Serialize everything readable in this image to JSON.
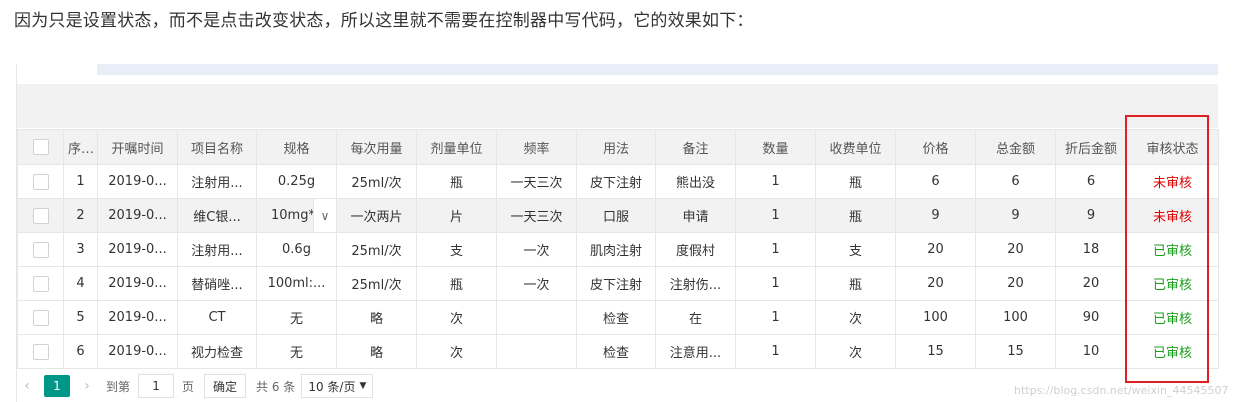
{
  "intro_text": "因为只是设置状态，而不是点击改变状态，所以这里就不需要在控制器中写代码，它的效果如下：",
  "columns": [
    "序号",
    "开嘱时间",
    "项目名称",
    "规格",
    "每次用量",
    "剂量单位",
    "频率",
    "用法",
    "备注",
    "数量",
    "收费单位",
    "价格",
    "总金额",
    "折后金额",
    "审核状态"
  ],
  "rows": [
    {
      "no": "1",
      "time": "2019-0...",
      "name": "注射用...",
      "spec": "0.25g",
      "dose": "25ml/次",
      "unit": "瓶",
      "freq": "一天三次",
      "usage": "皮下注射",
      "remark": "熊出没",
      "qty": "1",
      "charge_unit": "瓶",
      "price": "6",
      "total": "6",
      "discount": "6",
      "status": "未审核"
    },
    {
      "no": "2",
      "time": "2019-0...",
      "name": "维C银...",
      "spec": "10mg*...",
      "dose": "一次两片",
      "unit": "片",
      "freq": "一天三次",
      "usage": "口服",
      "remark": "申请",
      "qty": "1",
      "charge_unit": "瓶",
      "price": "9",
      "total": "9",
      "discount": "9",
      "status": "未审核"
    },
    {
      "no": "3",
      "time": "2019-0...",
      "name": "注射用...",
      "spec": "0.6g",
      "dose": "25ml/次",
      "unit": "支",
      "freq": "一次",
      "usage": "肌肉注射",
      "remark": "度假村",
      "qty": "1",
      "charge_unit": "支",
      "price": "20",
      "total": "20",
      "discount": "18",
      "status": "已审核"
    },
    {
      "no": "4",
      "time": "2019-0...",
      "name": "替硝唑...",
      "spec": "100ml:...",
      "dose": "25ml/次",
      "unit": "瓶",
      "freq": "一次",
      "usage": "皮下注射",
      "remark": "注射伤...",
      "qty": "1",
      "charge_unit": "瓶",
      "price": "20",
      "total": "20",
      "discount": "20",
      "status": "已审核"
    },
    {
      "no": "5",
      "time": "2019-0...",
      "name": "CT",
      "spec": "无",
      "dose": "略",
      "unit": "次",
      "freq": "",
      "usage": "检查",
      "remark": "在",
      "qty": "1",
      "charge_unit": "次",
      "price": "100",
      "total": "100",
      "discount": "90",
      "status": "已审核"
    },
    {
      "no": "6",
      "time": "2019-0...",
      "name": "视力检查",
      "spec": "无",
      "dose": "略",
      "unit": "次",
      "freq": "",
      "usage": "检查",
      "remark": "注意用...",
      "qty": "1",
      "charge_unit": "次",
      "price": "15",
      "total": "15",
      "discount": "10",
      "status": "已审核"
    }
  ],
  "pager": {
    "prev_icon": "chevron-left-icon",
    "current_page": "1",
    "next_icon": "chevron-right-icon",
    "goto_label": "到第",
    "goto_value": "1",
    "page_suffix": "页",
    "confirm_label": "确定",
    "total_label": "共 6 条",
    "page_size_label": "10 条/页"
  },
  "watermark": "https://blog.csdn.net/weixin_44545507",
  "colors": {
    "pending": "#e00000",
    "approved": "#1a9e1a",
    "pager_active": "#009688",
    "highlight_box": "#e02020"
  }
}
